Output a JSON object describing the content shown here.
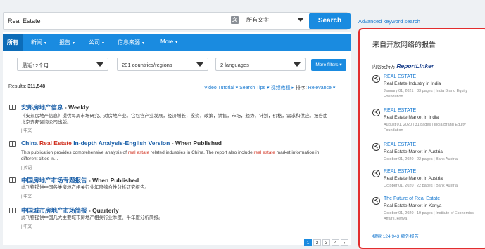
{
  "search": {
    "query": "Real Estate",
    "lang_icon_label": "文",
    "scope_selected": "所有文字",
    "button_label": "Search",
    "advanced_link": "Advanced keyword search"
  },
  "tabs": [
    {
      "label": "所有",
      "has_caret": false
    },
    {
      "label": "新闻",
      "has_caret": true
    },
    {
      "label": "报告",
      "has_caret": true
    },
    {
      "label": "公司",
      "has_caret": true
    },
    {
      "label": "信息来源",
      "has_caret": true
    },
    {
      "label": "More",
      "has_caret": true
    }
  ],
  "caret_glyph": "▾",
  "filters": {
    "period": "最近12个月",
    "regions": "201 countries/regions",
    "languages": "2 languages",
    "more_label": "More filters ▾"
  },
  "results": {
    "label": "Results:",
    "count": "311,548",
    "tool_video": "Video Tutorial ▾",
    "tool_tips": "Search Tips ▾",
    "tool_video_cn": "视频教程 ▸",
    "sort_label": "排序:",
    "sort_value": "Relevance ▾"
  },
  "items": [
    {
      "title_pre": "安邦房地产信息",
      "title_hl": "",
      "title_post": "",
      "freq": " - Weekly",
      "desc": "《安邦房地产信息》提供每周市场研究、对房地产业。它包含产业发展，经济增长，投资，政策，销售，市场，趋势，计划，价格，需求和供应。报告由北京安邦咨询公司出版。",
      "lang": "| 中文"
    },
    {
      "title_pre": "China ",
      "title_hl": "Real Estate",
      "title_post": " In-depth Analysis-English Version",
      "freq": " - When Published",
      "desc_parts": [
        "This publication provides comprehensive analysis of ",
        "real estate",
        " related industries in China. The report also include ",
        "real estate",
        " market information in different cities in..."
      ],
      "lang": "| 英语"
    },
    {
      "title_pre": "中国房地产市场专题报告",
      "title_hl": "",
      "title_post": "",
      "freq": " - When Published",
      "desc": "此刊物提供中国各类房地产相关行业年度综合性分析研究报告。",
      "lang": "| 中文"
    },
    {
      "title_pre": "中国城市房地产市场简报",
      "title_hl": "",
      "title_post": "",
      "freq": " - Quarterly",
      "desc": "此刊物提供中国几大主要城市房地产相关行业季度、半年度分析简报。",
      "lang": "| 中文"
    }
  ],
  "pagination": [
    "1",
    "2",
    "3",
    "4",
    "›"
  ],
  "side": {
    "title": "来自开放网络的报告",
    "powered_by": "内容支持方:",
    "brand": "ReportLinker",
    "items": [
      {
        "kind": "REAL ESTATE",
        "name": "Real Estate Industry in India",
        "meta": "January 01, 2021 | 33 pages | India Brand Equity Foundation"
      },
      {
        "kind": "REAL ESTATE",
        "name": "Real Estate Market in India",
        "meta": "August 01, 2020 | 31 pages | India Brand Equity Foundation"
      },
      {
        "kind": "REAL ESTATE",
        "name": "Real Estate Market in Austria",
        "meta": "October 01, 2020 | 22 pages | Bank Austria"
      },
      {
        "kind": "REAL ESTATE",
        "name": "Real Estate Market in Austria",
        "meta": "October 01, 2020 | 22 pages | Bank Austria"
      },
      {
        "kind": "The Future of Real Estate",
        "name": "Real Estate Market in Kenya",
        "meta": "October 01, 2020 | 19 pages | Institute of Economics Affairs, kenya"
      }
    ],
    "more_link": "搜索 124,943 额外报告"
  },
  "colors": {
    "accent": "#1a8be0",
    "highlight": "#d0301f",
    "panel_border": "#e22d2d"
  }
}
